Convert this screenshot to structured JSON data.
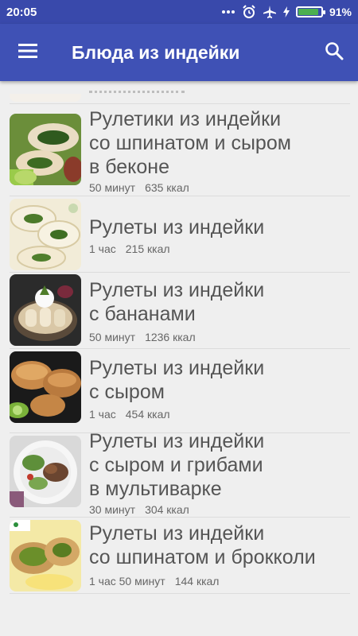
{
  "status": {
    "time": "20:05",
    "battery": "91%",
    "battery_level": 0.91
  },
  "app_bar": {
    "title": "Блюда из индейки"
  },
  "recipes": [
    {
      "title": "Рулетики из индейки\nсо шпинатом и сыром\nв беконе",
      "time": "50 минут",
      "kcal": "635 ккал"
    },
    {
      "title": "Рулеты из индейки",
      "time": "1 час",
      "kcal": "215 ккал"
    },
    {
      "title": "Рулеты из индейки\nс бананами",
      "time": "50 минут",
      "kcal": "1236 ккал"
    },
    {
      "title": "Рулеты из индейки\nс сыром",
      "time": "1 час",
      "kcal": "454 ккал"
    },
    {
      "title": "Рулеты из индейки\nс сыром и грибами\nв мультиварке",
      "time": "30 минут",
      "kcal": "304 ккал"
    },
    {
      "title": "Рулеты из индейки\nсо шпинатом и брокколи",
      "time": "1 час 50 минут",
      "kcal": "144 ккал"
    }
  ]
}
